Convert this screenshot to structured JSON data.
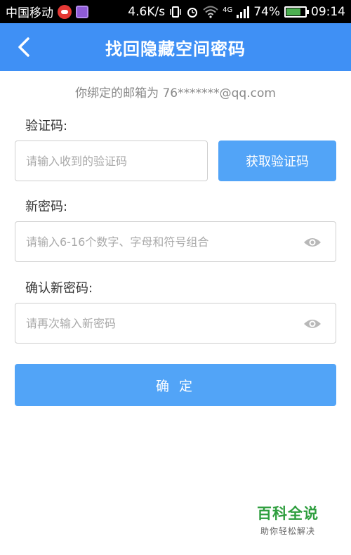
{
  "status_bar": {
    "carrier": "中国移动",
    "net_speed": "4.6K/s",
    "network_type": "4G",
    "battery": "74%",
    "time": "09:14"
  },
  "app_bar": {
    "title": "找回隐藏空间密码",
    "back_icon": "chevron-left-icon"
  },
  "hint": "你绑定的邮箱为 76*******@qq.com",
  "form": {
    "code": {
      "label": "验证码:",
      "placeholder": "请输入收到的验证码",
      "value": "",
      "get_code_label": "获取验证码"
    },
    "new_password": {
      "label": "新密码:",
      "placeholder": "请输入6-16个数字、字母和符号组合",
      "value": "",
      "toggle_icon": "eye-icon"
    },
    "confirm_password": {
      "label": "确认新密码:",
      "placeholder": "请再次输入新密码",
      "value": "",
      "toggle_icon": "eye-icon"
    },
    "submit_label": "确 定"
  },
  "watermark": {
    "title": "百科全说",
    "subtitle": "助你轻松解决"
  },
  "colors": {
    "primary": "#3f90f5",
    "button": "#52a4f7",
    "watermark": "#2e9e3e"
  }
}
